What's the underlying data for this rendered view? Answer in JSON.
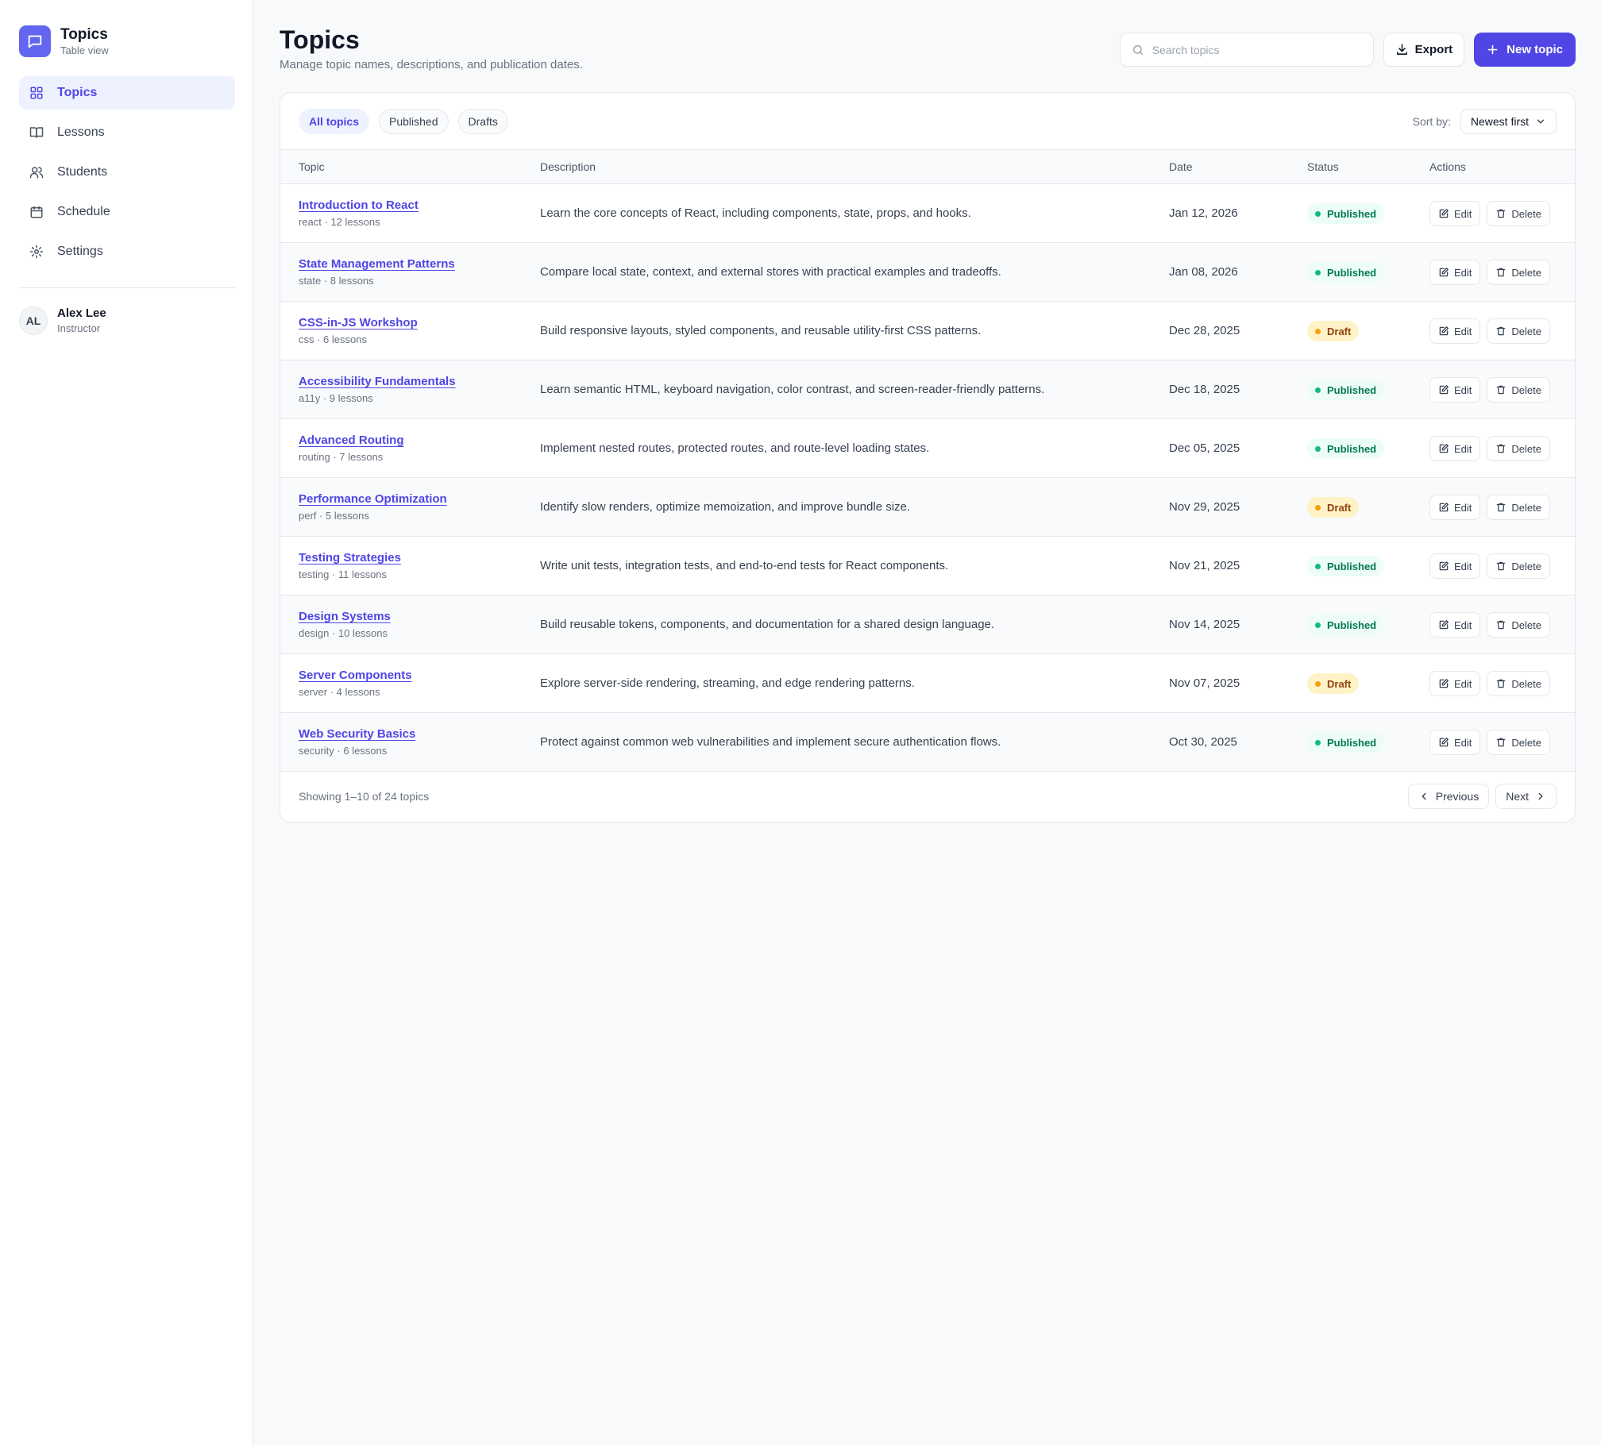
{
  "sidebar": {
    "brand_title": "Topics",
    "brand_subtitle": "Table view",
    "items": [
      {
        "label": "Topics",
        "icon": "grid-icon",
        "active": true
      },
      {
        "label": "Lessons",
        "icon": "book-icon",
        "active": false
      },
      {
        "label": "Students",
        "icon": "users-icon",
        "active": false
      },
      {
        "label": "Schedule",
        "icon": "calendar-icon",
        "active": false
      },
      {
        "label": "Settings",
        "icon": "gear-icon",
        "active": false
      }
    ],
    "user": {
      "initials": "AL",
      "name": "Alex Lee",
      "role": "Instructor"
    }
  },
  "header": {
    "title": "Topics",
    "subtitle": "Manage topic names, descriptions, and publication dates.",
    "search_placeholder": "Search topics",
    "search_value": "",
    "export_label": "Export",
    "new_label": "New topic"
  },
  "filters": {
    "chips": [
      "All topics",
      "Published",
      "Drafts"
    ],
    "active": "All topics",
    "sort_label": "Sort by:",
    "sort_value": "Newest first"
  },
  "table": {
    "columns": {
      "topic": "Topic",
      "description": "Description",
      "date": "Date",
      "status": "Status",
      "actions": "Actions"
    },
    "edit_label": "Edit",
    "delete_label": "Delete",
    "rows": [
      {
        "name": "Introduction to React",
        "meta": "react · 12 lessons",
        "description": "Learn the core concepts of React, including components, state, props, and hooks.",
        "date": "Jan 12, 2026",
        "status": "Published"
      },
      {
        "name": "State Management Patterns",
        "meta": "state · 8 lessons",
        "description": "Compare local state, context, and external stores with practical examples and tradeoffs.",
        "date": "Jan 08, 2026",
        "status": "Published"
      },
      {
        "name": "CSS-in-JS Workshop",
        "meta": "css · 6 lessons",
        "description": "Build responsive layouts, styled components, and reusable utility-first CSS patterns.",
        "date": "Dec 28, 2025",
        "status": "Draft"
      },
      {
        "name": "Accessibility Fundamentals",
        "meta": "a11y · 9 lessons",
        "description": "Learn semantic HTML, keyboard navigation, color contrast, and screen-reader-friendly patterns.",
        "date": "Dec 18, 2025",
        "status": "Published"
      },
      {
        "name": "Advanced Routing",
        "meta": "routing · 7 lessons",
        "description": "Implement nested routes, protected routes, and route-level loading states.",
        "date": "Dec 05, 2025",
        "status": "Published"
      },
      {
        "name": "Performance Optimization",
        "meta": "perf · 5 lessons",
        "description": "Identify slow renders, optimize memoization, and improve bundle size.",
        "date": "Nov 29, 2025",
        "status": "Draft"
      },
      {
        "name": "Testing Strategies",
        "meta": "testing · 11 lessons",
        "description": "Write unit tests, integration tests, and end-to-end tests for React components.",
        "date": "Nov 21, 2025",
        "status": "Published"
      },
      {
        "name": "Design Systems",
        "meta": "design · 10 lessons",
        "description": "Build reusable tokens, components, and documentation for a shared design language.",
        "date": "Nov 14, 2025",
        "status": "Published"
      },
      {
        "name": "Server Components",
        "meta": "server · 4 lessons",
        "description": "Explore server-side rendering, streaming, and edge rendering patterns.",
        "date": "Nov 07, 2025",
        "status": "Draft"
      },
      {
        "name": "Web Security Basics",
        "meta": "security · 6 lessons",
        "description": "Protect against common web vulnerabilities and implement secure authentication flows.",
        "date": "Oct 30, 2025",
        "status": "Published"
      }
    ]
  },
  "footer": {
    "showing": "Showing 1–10 of 24 topics",
    "previous_label": "Previous",
    "next_label": "Next"
  },
  "colors": {
    "accent": "#4f46e5",
    "published": "#10b981",
    "draft": "#f59e0b"
  }
}
